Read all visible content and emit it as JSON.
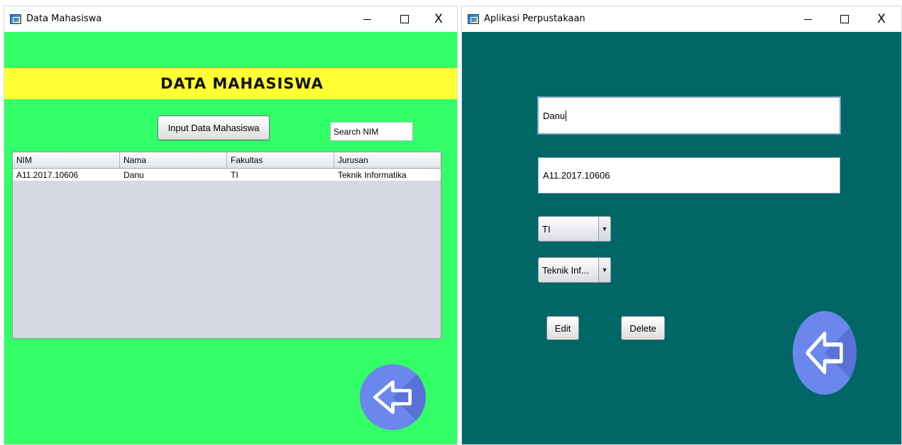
{
  "left_window": {
    "title": "Data Mahasiswa",
    "close_glyph": "X",
    "banner": "DATA MAHASISWA",
    "input_button": "Input Data Mahasiswa",
    "search_value": "Search NIM",
    "table": {
      "columns": [
        "NIM",
        "Nama",
        "Fakultas",
        "Jurusan"
      ],
      "rows": [
        [
          "A11.2017.10606",
          "Danu",
          "TI",
          "Teknik Informatika"
        ]
      ]
    },
    "colors": {
      "background": "#33ff66",
      "banner": "#ffff33",
      "back_button": "#6b87ee"
    },
    "back_icon": "arrow-left-icon"
  },
  "right_window": {
    "title": "Aplikasi Perpustakaan",
    "close_glyph": "X",
    "name_value": "Danu",
    "nim_value": "A11.2017.10606",
    "fakultas_selected": "TI",
    "jurusan_selected": "Teknik Inf...",
    "edit_button": "Edit",
    "delete_button": "Delete",
    "colors": {
      "background": "#006666",
      "back_button": "#6b87ee"
    },
    "back_icon": "arrow-left-icon"
  }
}
